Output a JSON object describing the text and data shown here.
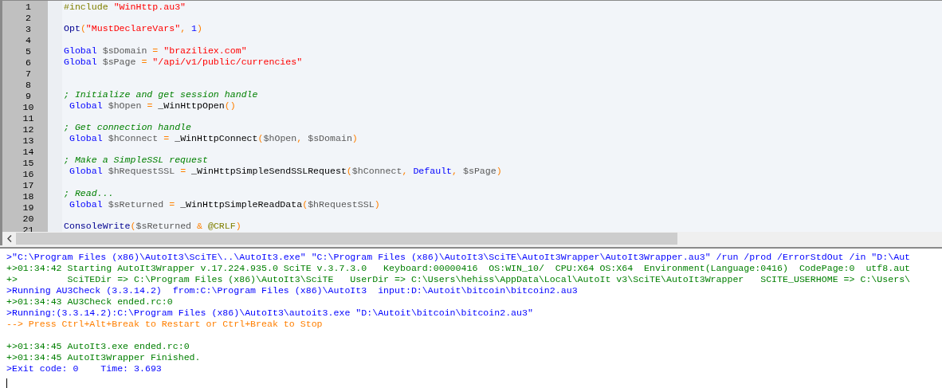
{
  "editor": {
    "lines": [
      {
        "number": "1",
        "tokens": [
          {
            "kind": "preprocessor",
            "text": "#include "
          },
          {
            "kind": "string",
            "text": "\"WinHttp.au3\""
          }
        ]
      },
      {
        "number": "2"
      },
      {
        "number": "3",
        "tokens": [
          {
            "kind": "builtin",
            "text": "Opt"
          },
          {
            "kind": "operator",
            "text": "("
          },
          {
            "kind": "string",
            "text": "\"MustDeclareVars\""
          },
          {
            "kind": "operator",
            "text": ", "
          },
          {
            "kind": "number",
            "text": "1"
          },
          {
            "kind": "operator",
            "text": ")"
          }
        ]
      },
      {
        "number": "4"
      },
      {
        "number": "5",
        "tokens": [
          {
            "kind": "keyword",
            "text": "Global "
          },
          {
            "kind": "variable",
            "text": "$sDomain "
          },
          {
            "kind": "operator",
            "text": "= "
          },
          {
            "kind": "string",
            "text": "\"braziliex.com\""
          }
        ]
      },
      {
        "number": "6",
        "tokens": [
          {
            "kind": "keyword",
            "text": "Global "
          },
          {
            "kind": "variable",
            "text": "$sPage "
          },
          {
            "kind": "operator",
            "text": "= "
          },
          {
            "kind": "string",
            "text": "\"/api/v1/public/currencies\""
          }
        ]
      },
      {
        "number": "7"
      },
      {
        "number": "8"
      },
      {
        "number": "9",
        "tokens": [
          {
            "kind": "comment",
            "text": "; Initialize and get session handle"
          }
        ]
      },
      {
        "number": "10",
        "tokens": [
          {
            "kind": "keyword",
            "text": " Global "
          },
          {
            "kind": "variable",
            "text": "$hOpen "
          },
          {
            "kind": "operator",
            "text": "= "
          },
          {
            "kind": "function",
            "text": "_WinHttpOpen"
          },
          {
            "kind": "operator",
            "text": "()"
          }
        ]
      },
      {
        "number": "11"
      },
      {
        "number": "12",
        "tokens": [
          {
            "kind": "comment",
            "text": "; Get connection handle"
          }
        ]
      },
      {
        "number": "13",
        "tokens": [
          {
            "kind": "keyword",
            "text": " Global "
          },
          {
            "kind": "variable",
            "text": "$hConnect "
          },
          {
            "kind": "operator",
            "text": "= "
          },
          {
            "kind": "function",
            "text": "_WinHttpConnect"
          },
          {
            "kind": "operator",
            "text": "("
          },
          {
            "kind": "variable",
            "text": "$hOpen"
          },
          {
            "kind": "operator",
            "text": ", "
          },
          {
            "kind": "variable",
            "text": "$sDomain"
          },
          {
            "kind": "operator",
            "text": ")"
          }
        ]
      },
      {
        "number": "14"
      },
      {
        "number": "15",
        "tokens": [
          {
            "kind": "comment",
            "text": "; Make a SimpleSSL request"
          }
        ]
      },
      {
        "number": "16",
        "tokens": [
          {
            "kind": "keyword",
            "text": " Global "
          },
          {
            "kind": "variable",
            "text": "$hRequestSSL "
          },
          {
            "kind": "operator",
            "text": "= "
          },
          {
            "kind": "function",
            "text": "_WinHttpSimpleSendSSLRequest"
          },
          {
            "kind": "operator",
            "text": "("
          },
          {
            "kind": "variable",
            "text": "$hConnect"
          },
          {
            "kind": "operator",
            "text": ", "
          },
          {
            "kind": "keyword",
            "text": "Default"
          },
          {
            "kind": "operator",
            "text": ", "
          },
          {
            "kind": "variable",
            "text": "$sPage"
          },
          {
            "kind": "operator",
            "text": ")"
          }
        ]
      },
      {
        "number": "17"
      },
      {
        "number": "18",
        "tokens": [
          {
            "kind": "comment",
            "text": "; Read..."
          }
        ]
      },
      {
        "number": "19",
        "tokens": [
          {
            "kind": "keyword",
            "text": " Global "
          },
          {
            "kind": "variable",
            "text": "$sReturned "
          },
          {
            "kind": "operator",
            "text": "= "
          },
          {
            "kind": "function",
            "text": "_WinHttpSimpleReadData"
          },
          {
            "kind": "operator",
            "text": "("
          },
          {
            "kind": "variable",
            "text": "$hRequestSSL"
          },
          {
            "kind": "operator",
            "text": ")"
          }
        ]
      },
      {
        "number": "20"
      },
      {
        "number": "21",
        "tokens": [
          {
            "kind": "builtin",
            "text": "ConsoleWrite"
          },
          {
            "kind": "operator",
            "text": "("
          },
          {
            "kind": "variable",
            "text": "$sReturned "
          },
          {
            "kind": "operator",
            "text": "& "
          },
          {
            "kind": "macro",
            "text": "@CRLF"
          },
          {
            "kind": "operator",
            "text": ")"
          }
        ]
      }
    ]
  },
  "output": {
    "lines": [
      {
        "kind": "command",
        "text": ">\"C:\\Program Files (x86)\\AutoIt3\\SciTE\\..\\AutoIt3.exe\" \"C:\\Program Files (x86)\\AutoIt3\\SciTE\\AutoIt3Wrapper\\AutoIt3Wrapper.au3\" /run /prod /ErrorStdOut /in \"D:\\Aut"
      },
      {
        "kind": "success",
        "text": "+>01:34:42 Starting AutoIt3Wrapper v.17.224.935.0 SciTE v.3.7.3.0   Keyboard:00000416  OS:WIN_10/  CPU:X64 OS:X64  Environment(Language:0416)  CodePage:0  utf8.aut"
      },
      {
        "kind": "success",
        "text": "+>         SciTEDir => C:\\Program Files (x86)\\AutoIt3\\SciTE   UserDir => C:\\Users\\hehiss\\AppData\\Local\\AutoIt v3\\SciTE\\AutoIt3Wrapper   SCITE_USERHOME => C:\\Users\\"
      },
      {
        "kind": "command",
        "text": ">Running AU3Check (3.3.14.2)  from:C:\\Program Files (x86)\\AutoIt3  input:D:\\Autoit\\bitcoin\\bitcoin2.au3"
      },
      {
        "kind": "success",
        "text": "+>01:34:43 AU3Check ended.rc:0"
      },
      {
        "kind": "command",
        "text": ">Running:(3.3.14.2):C:\\Program Files (x86)\\AutoIt3\\autoit3.exe \"D:\\Autoit\\bitcoin\\bitcoin2.au3\""
      },
      {
        "kind": "hint",
        "text": "--> Press Ctrl+Alt+Break to Restart or Ctrl+Break to Stop"
      },
      {
        "kind": "blank"
      },
      {
        "kind": "success",
        "text": "+>01:34:45 AutoIt3.exe ended.rc:0"
      },
      {
        "kind": "success",
        "text": "+>01:34:45 AutoIt3Wrapper Finished."
      },
      {
        "kind": "command",
        "text": ">Exit code: 0    Time: 3.693"
      }
    ]
  }
}
